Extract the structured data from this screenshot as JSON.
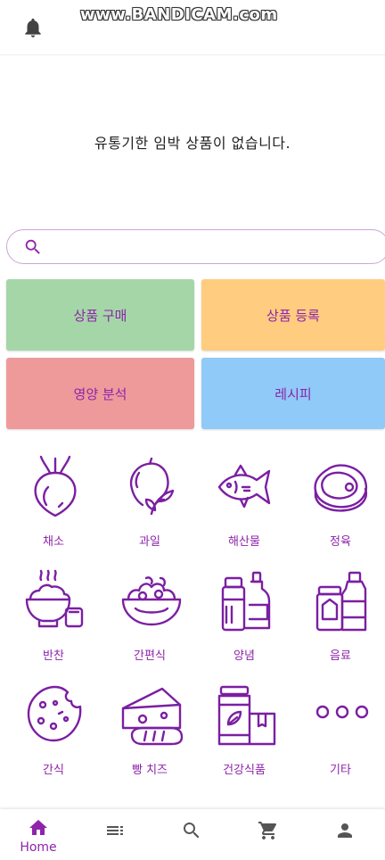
{
  "watermark": "www.BANDICAM.com",
  "notice": "유통기한 임박 상품이 없습니다.",
  "search": {
    "placeholder": "",
    "value": ""
  },
  "tiles": [
    {
      "label": "상품 구매",
      "color": "#a5d6a7"
    },
    {
      "label": "상품 등록",
      "color": "#ffcc80"
    },
    {
      "label": "영양 분석",
      "color": "#ef9a9a"
    },
    {
      "label": "레시피",
      "color": "#90caf9"
    }
  ],
  "categories": [
    {
      "label": "채소",
      "icon": "beet-icon"
    },
    {
      "label": "과일",
      "icon": "fruit-icon"
    },
    {
      "label": "해산물",
      "icon": "fish-icon"
    },
    {
      "label": "정육",
      "icon": "steak-icon"
    },
    {
      "label": "반찬",
      "icon": "rice-bowl-icon"
    },
    {
      "label": "간편식",
      "icon": "salad-bowl-icon"
    },
    {
      "label": "양념",
      "icon": "condiment-bottles-icon"
    },
    {
      "label": "음료",
      "icon": "drink-bottles-icon"
    },
    {
      "label": "간식",
      "icon": "cookie-icon"
    },
    {
      "label": "빵 치즈",
      "icon": "bread-cheese-icon"
    },
    {
      "label": "건강식품",
      "icon": "health-food-icon"
    },
    {
      "label": "기타",
      "icon": "more-dots-icon"
    }
  ],
  "bottom_nav": {
    "home_label": "Home",
    "items": [
      "home-icon",
      "list-icon",
      "search-icon",
      "cart-icon",
      "person-icon"
    ]
  },
  "colors": {
    "accent": "#8e24aa",
    "icon_stroke": "#7b1fa2",
    "search_border": "#c9a6d9"
  }
}
